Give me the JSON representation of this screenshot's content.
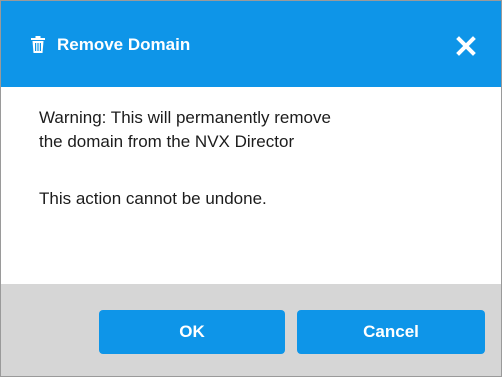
{
  "dialog": {
    "title": "Remove Domain",
    "title_icon": "trash-icon",
    "close_icon": "close-icon",
    "warning_line_1": "Warning: This will permanently remove",
    "warning_line_2": "the domain from the NVX Director",
    "undone_text": "This action cannot be undone.",
    "ok_label": "OK",
    "cancel_label": "Cancel"
  },
  "colors": {
    "accent": "#0e95e8",
    "footer_bg": "#d6d6d6",
    "text": "#1c1c1c"
  }
}
